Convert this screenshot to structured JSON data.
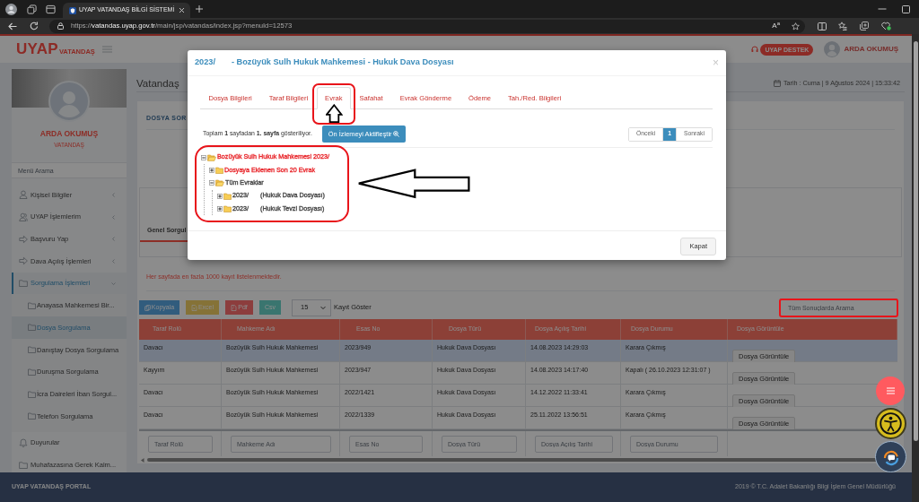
{
  "browser": {
    "tab_title": "UYAP VATANDAŞ BİLGİ SİSTEMİ",
    "url_scheme": "https://",
    "url_host": "vatandas.uyap.gov.tr",
    "url_path": "/main/jsp/vatandas/index.jsp?menuId=12573",
    "read_aloud": "A$^{a}$"
  },
  "header": {
    "logo": "UYAP",
    "logo_subtitle": "VATANDAŞ",
    "support_button": "UYAP DESTEK",
    "user_name": "ARDA OKUMUŞ"
  },
  "sidebar": {
    "profile_name": "ARDA OKUMUŞ",
    "profile_role": "VATANDAŞ",
    "search": {
      "placeholder": "Menü Arama"
    },
    "items": [
      {
        "label": "Kişisel Bilgiler",
        "kind": "submenu",
        "expanded": false,
        "selected": false
      },
      {
        "label": "UYAP İşlemlerim",
        "kind": "submenu",
        "expanded": false,
        "selected": false
      },
      {
        "label": "Başvuru Yap",
        "kind": "submenu",
        "expanded": false,
        "selected": false
      },
      {
        "label": "Dava Açılış İşlemleri",
        "kind": "submenu",
        "expanded": false,
        "selected": false
      },
      {
        "label": "Sorgulama İşlemleri",
        "kind": "submenu",
        "expanded": true,
        "selected": true,
        "children": [
          {
            "label": "Anayasa Mahkemesi Bir...",
            "selected": false
          },
          {
            "label": "Dosya Sorgulama",
            "selected": true
          },
          {
            "label": "Danıştay Dosya Sorgulama",
            "selected": false
          },
          {
            "label": "Duruşma Sorgulama",
            "selected": false
          },
          {
            "label": "İcra Daireleri İban Sorgul...",
            "selected": false
          },
          {
            "label": "Telefon Sorgulama",
            "selected": false
          }
        ]
      },
      {
        "label": "Duyurular",
        "kind": "link",
        "selected": false
      },
      {
        "label": "Muhafazasına Gerek Kalm...",
        "kind": "link",
        "selected": false
      }
    ]
  },
  "main": {
    "page_title": "Vatandaş",
    "date": "Tarih : Cuma | 9 Ağustos 2024 | 15:33:42",
    "card_title": "DOSYA SOR",
    "query_tab": "Genel Sorgul",
    "notice": "Her sayfada en fazla 1000 kayıt listelenmektedir.",
    "export_buttons": [
      {
        "label": "Kopyala",
        "kind": "copy"
      },
      {
        "label": "Excel",
        "kind": "excel"
      },
      {
        "label": "Pdf",
        "kind": "pdf"
      },
      {
        "label": "Csv",
        "kind": "csv"
      }
    ],
    "page_length": {
      "value": "15",
      "label": "Kayıt Göster"
    },
    "search": {
      "placeholder": "Tüm Sonuçlarda Arama"
    },
    "table": {
      "columns": [
        "Taraf Rolü",
        "Mahkeme Adı",
        "Esas No",
        "Dosya Türü",
        "Dosya Açılış Tarihi",
        "Dosya Durumu",
        "Dosya Görüntüle"
      ],
      "rows": [
        {
          "cells": [
            "Davacı",
            "Bozüyük Sulh Hukuk Mahkemesi",
            "2023/949",
            "Hukuk Dava Dosyası",
            "14.08.2023 14:29:03",
            "Karara Çıkmış"
          ],
          "action": "Dosya Görüntüle",
          "selected": true
        },
        {
          "cells": [
            "Kayyım",
            "Bozüyük Sulh Hukuk Mahkemesi",
            "2023/947",
            "Hukuk Dava Dosyası",
            "14.08.2023 14:17:40",
            "Kapalı ( 26.10.2023 12:31:07 )"
          ],
          "action": "Dosya Görüntüle",
          "selected": false
        },
        {
          "cells": [
            "Davacı",
            "Bozüyük Sulh Hukuk Mahkemesi",
            "2022/1421",
            "Hukuk Dava Dosyası",
            "14.12.2022 11:33:41",
            "Karara Çıkmış"
          ],
          "action": "Dosya Görüntüle",
          "selected": false
        },
        {
          "cells": [
            "Davacı",
            "Bozüyük Sulh Hukuk Mahkemesi",
            "2022/1339",
            "Hukuk Dava Dosyası",
            "25.11.2022 13:56:51",
            "Karara Çıkmış"
          ],
          "action": "Dosya Görüntüle",
          "selected": false
        }
      ],
      "filters": [
        {
          "placeholder": "Taraf Rolü"
        },
        {
          "placeholder": "Mahkeme Adı"
        },
        {
          "placeholder": "Esas No"
        },
        {
          "placeholder": "Dosya Türü"
        },
        {
          "placeholder": "Dosya Açılış Tarihi"
        },
        {
          "placeholder": "Dosya Durumu"
        }
      ]
    }
  },
  "modal": {
    "title_number": "2023/",
    "title": "- Bozüyük Sulh Hukuk Mahkemesi - Hukuk Dava Dosyası",
    "close": "×",
    "tabs": [
      {
        "label": "Dosya Bilgileri",
        "selected": false
      },
      {
        "label": "Taraf Bilgileri",
        "selected": false
      },
      {
        "label": "Evrak",
        "selected": true
      },
      {
        "label": "Safahat",
        "selected": false
      },
      {
        "label": "Evrak Gönderme",
        "selected": false
      },
      {
        "label": "Ödeme",
        "selected": false
      },
      {
        "label": "Tah./Red. Bilgileri",
        "selected": false
      }
    ],
    "summary": "Toplam **1** sayfadan **1. sayfa** gösteriliyor.",
    "preview_button": "Ön İzlemeyi Aktifleştir",
    "pagination": [
      {
        "label": "Önceki",
        "selected": false
      },
      {
        "label": "1",
        "selected": true
      },
      {
        "label": "Sonraki",
        "selected": false
      }
    ],
    "tree": [
      {
        "label": "Bozüyük Sulh Hukuk Mahkemesi 2023/",
        "color": "#e8262b",
        "expanded": true,
        "children": [
          {
            "label": "Dosyaya Eklenen Son 20 Evrak",
            "color": "#e8262b",
            "expanded": false
          },
          {
            "label": "Tüm Evraklar",
            "color": "#444444",
            "expanded": true,
            "children": [
              {
                "label": "2023/",
                "note": "(Hukuk Dava Dosyası)",
                "color": "#444444",
                "expanded": false
              },
              {
                "label": "2023/",
                "note": "(Hukuk Tevzi Dosyası)",
                "color": "#444444",
                "expanded": false
              }
            ]
          }
        ]
      }
    ],
    "close_button": "Kapat"
  },
  "footer": {
    "left": "UYAP VATANDAŞ PORTAL",
    "right": "2019 © T.C. Adalet Bakanlığı Bilgi İşlem Genel Müdürlüğü"
  }
}
